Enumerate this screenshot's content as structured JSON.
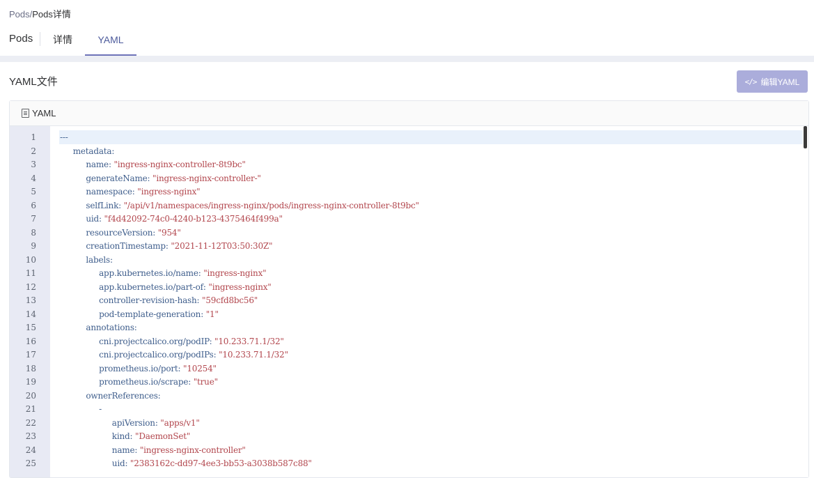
{
  "breadcrumb": {
    "parent": "Pods",
    "separator": "/",
    "current": "Pods详情"
  },
  "tabs": {
    "back": "Pods",
    "detail": "详情",
    "yaml": "YAML",
    "active": "YAML"
  },
  "section": {
    "title": "YAML文件",
    "edit_button": "编辑YAML",
    "edit_icon": "</>"
  },
  "panel": {
    "title": "YAML",
    "icon": "document-icon"
  },
  "colors": {
    "accent": "#6e73b8",
    "button": "#abaddb",
    "key": "#3f5e8c",
    "value": "#b2464d",
    "gutter": "#e8eaf4"
  },
  "code_lines": [
    {
      "n": "1",
      "indent": 0,
      "raw": "---"
    },
    {
      "n": "2",
      "indent": 1,
      "key": "metadata:"
    },
    {
      "n": "3",
      "indent": 2,
      "key": "name:",
      "value": "\"ingress-nginx-controller-8t9bc\""
    },
    {
      "n": "4",
      "indent": 2,
      "key": "generateName:",
      "value": "\"ingress-nginx-controller-\""
    },
    {
      "n": "5",
      "indent": 2,
      "key": "namespace:",
      "value": "\"ingress-nginx\""
    },
    {
      "n": "6",
      "indent": 2,
      "key": "selfLink:",
      "value": "\"/api/v1/namespaces/ingress-nginx/pods/ingress-nginx-controller-8t9bc\""
    },
    {
      "n": "7",
      "indent": 2,
      "key": "uid:",
      "value": "\"f4d42092-74c0-4240-b123-4375464f499a\""
    },
    {
      "n": "8",
      "indent": 2,
      "key": "resourceVersion:",
      "value": "\"954\""
    },
    {
      "n": "9",
      "indent": 2,
      "key": "creationTimestamp:",
      "value": "\"2021-11-12T03:50:30Z\""
    },
    {
      "n": "10",
      "indent": 2,
      "key": "labels:"
    },
    {
      "n": "11",
      "indent": 3,
      "key": "app.kubernetes.io/name:",
      "value": "\"ingress-nginx\""
    },
    {
      "n": "12",
      "indent": 3,
      "key": "app.kubernetes.io/part-of:",
      "value": "\"ingress-nginx\""
    },
    {
      "n": "13",
      "indent": 3,
      "key": "controller-revision-hash:",
      "value": "\"59cfd8bc56\""
    },
    {
      "n": "14",
      "indent": 3,
      "key": "pod-template-generation:",
      "value": "\"1\""
    },
    {
      "n": "15",
      "indent": 2,
      "key": "annotations:"
    },
    {
      "n": "16",
      "indent": 3,
      "key": "cni.projectcalico.org/podIP:",
      "value": "\"10.233.71.1/32\""
    },
    {
      "n": "17",
      "indent": 3,
      "key": "cni.projectcalico.org/podIPs:",
      "value": "\"10.233.71.1/32\""
    },
    {
      "n": "18",
      "indent": 3,
      "key": "prometheus.io/port:",
      "value": "\"10254\""
    },
    {
      "n": "19",
      "indent": 3,
      "key": "prometheus.io/scrape:",
      "value": "\"true\""
    },
    {
      "n": "20",
      "indent": 2,
      "key": "ownerReferences:"
    },
    {
      "n": "21",
      "indent": 3,
      "raw": "-"
    },
    {
      "n": "22",
      "indent": 4,
      "key": "apiVersion:",
      "value": "\"apps/v1\""
    },
    {
      "n": "23",
      "indent": 4,
      "key": "kind:",
      "value": "\"DaemonSet\""
    },
    {
      "n": "24",
      "indent": 4,
      "key": "name:",
      "value": "\"ingress-nginx-controller\""
    },
    {
      "n": "25",
      "indent": 4,
      "key": "uid:",
      "value": "\"2383162c-dd97-4ee3-bb53-a3038b587c88\""
    }
  ]
}
